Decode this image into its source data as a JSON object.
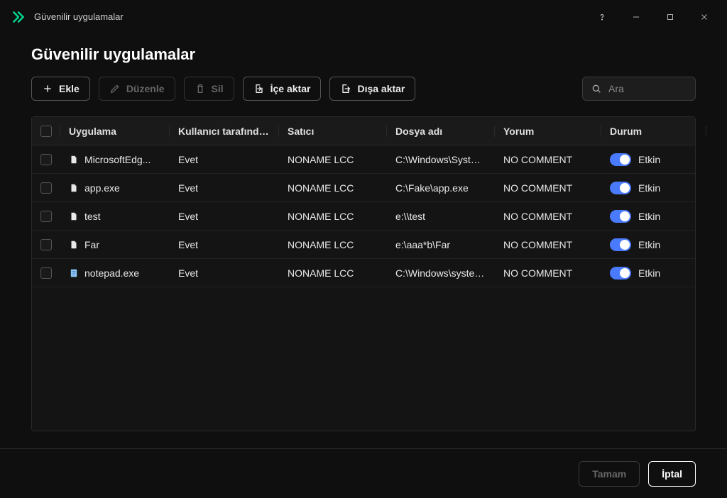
{
  "window": {
    "title": "Güvenilir uygulamalar"
  },
  "page": {
    "heading": "Güvenilir uygulamalar"
  },
  "toolbar": {
    "add": "Ekle",
    "edit": "Düzenle",
    "delete": "Sil",
    "import": "İçe aktar",
    "export": "Dışa aktar"
  },
  "search": {
    "placeholder": "Ara"
  },
  "table": {
    "headers": {
      "app": "Uygulama",
      "user": "Kullanıcı tarafında...",
      "vendor": "Satıcı",
      "file": "Dosya adı",
      "comment": "Yorum",
      "status": "Durum"
    },
    "rows": [
      {
        "app": "MicrosoftEdg...",
        "user": "Evet",
        "vendor": "NONAME LCC",
        "file": "C:\\Windows\\System...",
        "comment": "NO COMMENT",
        "status": "Etkin"
      },
      {
        "app": "app.exe",
        "user": "Evet",
        "vendor": "NONAME LCC",
        "file": "C:\\Fake\\app.exe",
        "comment": "NO COMMENT",
        "status": "Etkin"
      },
      {
        "app": "test",
        "user": "Evet",
        "vendor": "NONAME LCC",
        "file": "e:\\\\test",
        "comment": "NO COMMENT",
        "status": "Etkin"
      },
      {
        "app": "Far",
        "user": "Evet",
        "vendor": "NONAME LCC",
        "file": "e:\\aaa*b\\Far",
        "comment": "NO COMMENT",
        "status": "Etkin"
      },
      {
        "app": "notepad.exe",
        "user": "Evet",
        "vendor": "NONAME LCC",
        "file": "C:\\Windows\\system...",
        "comment": "NO COMMENT",
        "status": "Etkin"
      }
    ]
  },
  "footer": {
    "ok": "Tamam",
    "cancel": "İptal"
  }
}
